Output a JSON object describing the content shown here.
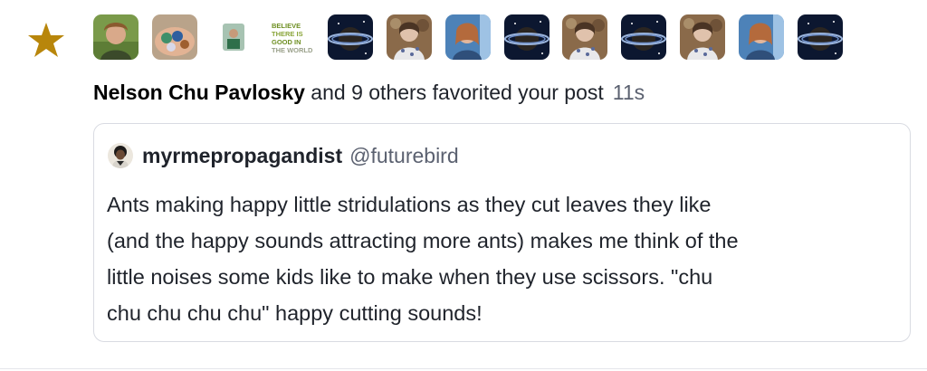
{
  "notification": {
    "type": "favourite",
    "icon": "star-icon",
    "accent_color": "#b8860b",
    "avatars": [
      {
        "name": "avatar-1",
        "style": "person-green"
      },
      {
        "name": "avatar-2",
        "style": "hand-marbles"
      },
      {
        "name": "avatar-3",
        "style": "small-person"
      },
      {
        "name": "avatar-4",
        "style": "believe-text"
      },
      {
        "name": "avatar-5",
        "style": "planet"
      },
      {
        "name": "avatar-6",
        "style": "person-floral"
      },
      {
        "name": "avatar-7",
        "style": "person-blue"
      },
      {
        "name": "avatar-8",
        "style": "planet"
      },
      {
        "name": "avatar-9",
        "style": "person-floral"
      },
      {
        "name": "avatar-10",
        "style": "planet"
      },
      {
        "name": "avatar-11",
        "style": "person-floral"
      },
      {
        "name": "avatar-12",
        "style": "person-blue"
      },
      {
        "name": "avatar-13",
        "style": "planet"
      }
    ],
    "believe_lines": [
      "BELIEVE",
      "THERE IS",
      "GOOD IN",
      "THE WORLD"
    ],
    "actor_name": "Nelson Chu Pavlosky",
    "action_text": " and 9 others favorited your post",
    "relative_time": "11s"
  },
  "status": {
    "display_name": "myrmepropagandist",
    "handle": "@futurebird",
    "content": "Ants making happy little stridulations as they cut leaves they like\n(and the happy sounds attracting more ants) makes me think of the\nlittle noises some kids like to make when they use scissors.  \"chu\nchu chu chu chu\" happy cutting sounds!"
  }
}
